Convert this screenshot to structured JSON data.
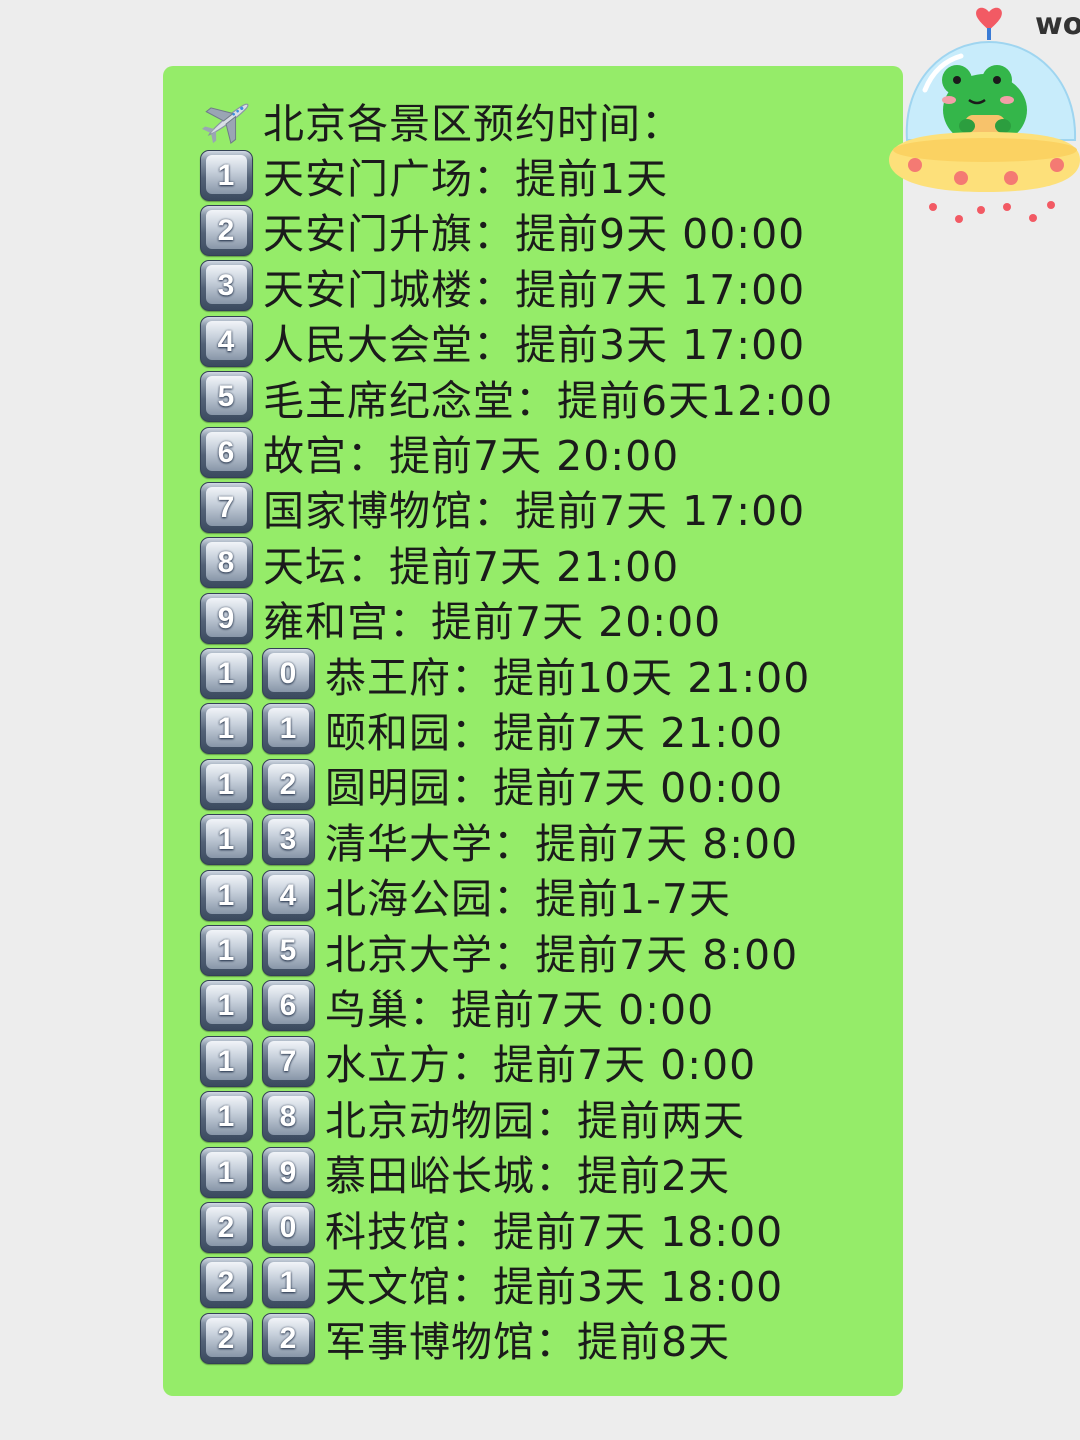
{
  "title": "北京各景区预约时间：",
  "items": [
    {
      "num": "1",
      "text": "天安门广场：提前1天"
    },
    {
      "num": "2",
      "text": "天安门升旗：提前9天 00:00"
    },
    {
      "num": "3",
      "text": "天安门城楼：提前7天 17:00"
    },
    {
      "num": "4",
      "text": "人民大会堂：提前3天 17:00"
    },
    {
      "num": "5",
      "text": "毛主席纪念堂：提前6天12:00"
    },
    {
      "num": "6",
      "text": "故宫：提前7天 20:00"
    },
    {
      "num": "7",
      "text": "国家博物馆：提前7天 17:00"
    },
    {
      "num": "8",
      "text": "天坛：提前7天 21:00"
    },
    {
      "num": "9",
      "text": "雍和宫：提前7天 20:00"
    },
    {
      "num": "10",
      "text": "恭王府：提前10天 21:00"
    },
    {
      "num": "11",
      "text": "颐和园：提前7天 21:00"
    },
    {
      "num": "12",
      "text": "圆明园：提前7天 00:00"
    },
    {
      "num": "13",
      "text": "清华大学：提前7天 8:00"
    },
    {
      "num": "14",
      "text": "北海公园：提前1-7天"
    },
    {
      "num": "15",
      "text": "北京大学：提前7天 8:00"
    },
    {
      "num": "16",
      "text": "鸟巢：提前7天 0:00"
    },
    {
      "num": "17",
      "text": "水立方：提前7天 0:00"
    },
    {
      "num": "18",
      "text": "北京动物园：提前两天"
    },
    {
      "num": "19",
      "text": "慕田峪长城：提前2天"
    },
    {
      "num": "20",
      "text": "科技馆：提前7天 18:00"
    },
    {
      "num": "21",
      "text": "天文馆：提前3天 18:00"
    },
    {
      "num": "22",
      "text": "军事博物馆：提前8天"
    }
  ],
  "sticker_text": "wo",
  "colors": {
    "background": "#ededed",
    "bubble": "#95ec69",
    "text": "#1b1b1b",
    "keycap": "#526176"
  },
  "icons": {
    "title": "airplane-icon",
    "numbers": "keycap-digit-icon",
    "sticker": "frog-ufo-sticker"
  }
}
